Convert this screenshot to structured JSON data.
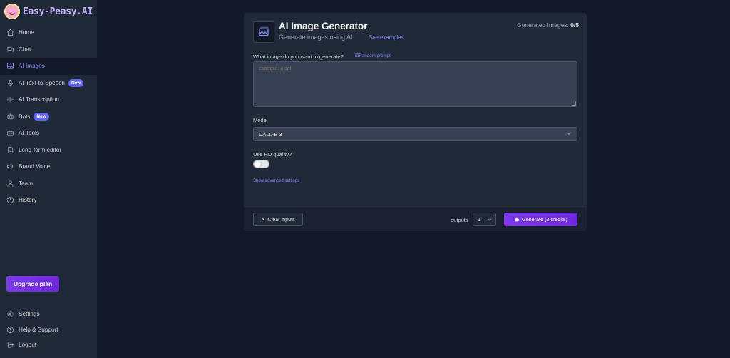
{
  "app": {
    "name": "Easy-Peasy.AI"
  },
  "sidebar": {
    "items": [
      {
        "label": "Home",
        "icon": "home-icon"
      },
      {
        "label": "Chat",
        "icon": "chat-icon"
      },
      {
        "label": "AI Images",
        "icon": "image-icon",
        "active": true
      },
      {
        "label": "AI Text-to-Speech",
        "icon": "microphone-icon",
        "badge": "New"
      },
      {
        "label": "AI Transcription",
        "icon": "waveform-icon"
      },
      {
        "label": "Bots",
        "icon": "robot-icon",
        "badge": "New"
      },
      {
        "label": "AI Tools",
        "icon": "toolbox-icon"
      },
      {
        "label": "Long-form editor",
        "icon": "document-icon"
      },
      {
        "label": "Brand Voice",
        "icon": "megaphone-icon"
      },
      {
        "label": "Team",
        "icon": "team-icon"
      },
      {
        "label": "History",
        "icon": "history-icon"
      }
    ],
    "upgrade_label": "Upgrade plan",
    "bottom_items": [
      {
        "label": "Settings",
        "icon": "gear-icon"
      },
      {
        "label": "Help & Support",
        "icon": "help-icon"
      },
      {
        "label": "Logout",
        "icon": "logout-icon"
      }
    ]
  },
  "generator": {
    "title": "AI Image Generator",
    "subtitle": "Generate images using AI",
    "see_examples": "See examples",
    "generated_label": "Generated Images: ",
    "generated_count": "0/5",
    "prompt_label": "What image do you want to generate?",
    "random_prompt": "Random prompt",
    "prompt_placeholder": "example: a cat",
    "prompt_value": "",
    "model_label": "Model",
    "model_value": "DALL-E 3",
    "hd_label": "Use HD quality?",
    "hd_enabled": false,
    "advanced_link": "Show advanced settings",
    "clear_label": "Clear inputs",
    "outputs_label": "outputs",
    "outputs_value": "1",
    "generate_label": "Generate (2 credits)"
  },
  "colors": {
    "accent": "#7c3aed",
    "link": "#818cf8",
    "background": "#111827",
    "panel": "#1f2937"
  }
}
